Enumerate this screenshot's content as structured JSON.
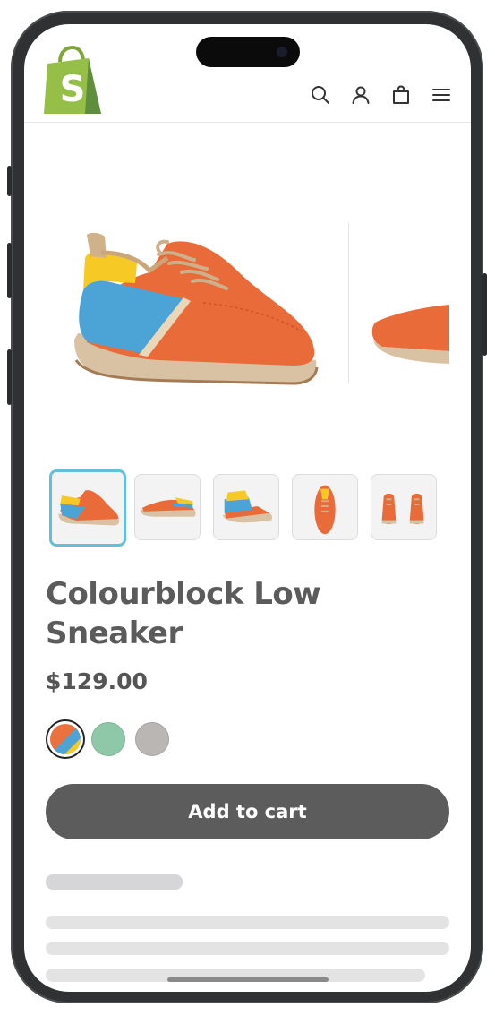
{
  "product": {
    "title": "Colourblock Low Sneaker",
    "price": "$129.00",
    "add_to_cart_label": "Add to cart"
  },
  "header": {
    "icons": [
      "search-icon",
      "account-icon",
      "cart-bag-icon",
      "menu-icon"
    ]
  },
  "gallery": {
    "thumbnails": [
      "thumb-side-view",
      "thumb-angle-view",
      "thumb-rear-view",
      "thumb-top-view",
      "thumb-pair-front"
    ],
    "selected_index": 0
  },
  "swatches": [
    {
      "name": "multicolour",
      "color": "#e8733e",
      "selected": true
    },
    {
      "name": "green",
      "color": "#8ec8a8",
      "selected": false
    },
    {
      "name": "grey",
      "color": "#b9b6b3",
      "selected": false
    }
  ],
  "colors": {
    "shoe_orange": "#ea6b3a",
    "shoe_blue": "#4ca3d6",
    "shoe_yellow": "#f7c925",
    "sole_beige": "#d7bfa0",
    "button_bg": "#5c5c5c",
    "thumb_active_border": "#65bfd6",
    "shopify_green": "#95bf47"
  }
}
